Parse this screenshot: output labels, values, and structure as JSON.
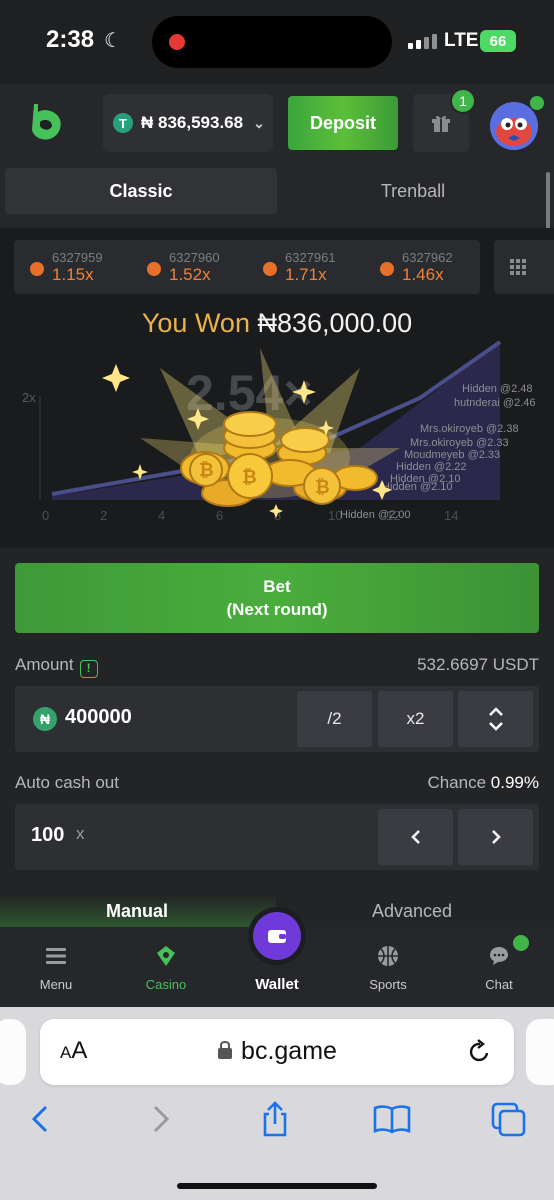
{
  "status_bar": {
    "time": "2:38",
    "network": "LTE",
    "battery": "66"
  },
  "header": {
    "balance": "₦ 836,593.68",
    "deposit_label": "Deposit",
    "gift_badge": "1"
  },
  "mode_tabs": [
    {
      "label": "Classic"
    },
    {
      "label": "Trenball"
    }
  ],
  "history": [
    {
      "id": "6327959",
      "mult": "1.15x"
    },
    {
      "id": "6327960",
      "mult": "1.52x"
    },
    {
      "id": "6327961",
      "mult": "1.71x"
    },
    {
      "id": "6327962",
      "mult": "1.46x"
    }
  ],
  "game": {
    "won_label": "You Won",
    "won_amount": "₦836,000.00",
    "multiplier": "2.54×",
    "ytick": "2x",
    "xticks": [
      "0",
      "2",
      "4",
      "6",
      "8",
      "10",
      "12",
      "14"
    ],
    "cashouts": [
      "Hidden @2.48",
      "hutnderai @2.46",
      "Mrs.okiroyeb @2.38",
      "Mrs.okiroyeb @2.33",
      "Moudmeyeb @2.33",
      "Hidden @2.22",
      "Hidden @2.10",
      "Hidden @2.10",
      "Hidden @2.00"
    ]
  },
  "bet": {
    "line1": "Bet",
    "line2": "(Next round)"
  },
  "amount": {
    "label": "Amount",
    "usdt_value": "532.6697 USDT",
    "value": "400000",
    "half": "/2",
    "double": "x2"
  },
  "auto_cashout": {
    "label": "Auto cash out",
    "chance_label": "Chance",
    "chance_value": "0.99%",
    "value": "100",
    "suffix": "x"
  },
  "subtabs": {
    "manual": "Manual",
    "advanced": "Advanced"
  },
  "nav": {
    "menu": "Menu",
    "casino": "Casino",
    "wallet": "Wallet",
    "sports": "Sports",
    "chat": "Chat"
  },
  "safari": {
    "aa": "AA",
    "url": "bc.game"
  },
  "colors": {
    "accent_green": "#47c25a",
    "orange": "#f0813a",
    "gold": "#e9b24a",
    "wallet_purple": "#6f3ad9"
  }
}
